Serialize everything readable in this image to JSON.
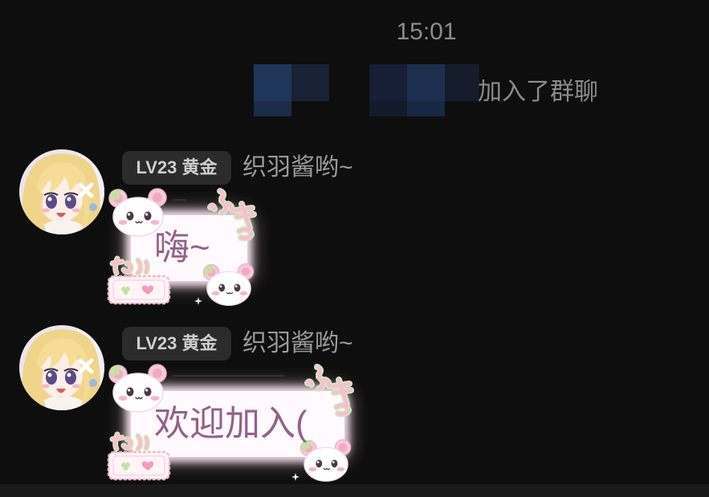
{
  "timestamp": "15:01",
  "system_message": {
    "text": "加入了群聊"
  },
  "messages": [
    {
      "badge": "LV23 黄金",
      "sender": "织羽酱哟~",
      "text": "嗨~"
    },
    {
      "badge": "LV23 黄金",
      "sender": "织羽酱哟~",
      "text": "欢迎加入("
    }
  ],
  "colors": {
    "background": "#0e0e0e",
    "muted_text": "#8b8b8b",
    "sender_text": "#9a9a9a",
    "badge_background": "#2b2b2b",
    "badge_text": "#cfcfcf",
    "bubble_text": "#93628a",
    "bubble_background": "#fffafd",
    "bottom_bar": "#1a1a1a"
  },
  "icons": {
    "avatar": "anime-girl-avatar",
    "redaction": "mosaic",
    "bubble_decorations": [
      "panda-sticker",
      "kana-sticker",
      "heart-tag",
      "sparkle"
    ]
  }
}
